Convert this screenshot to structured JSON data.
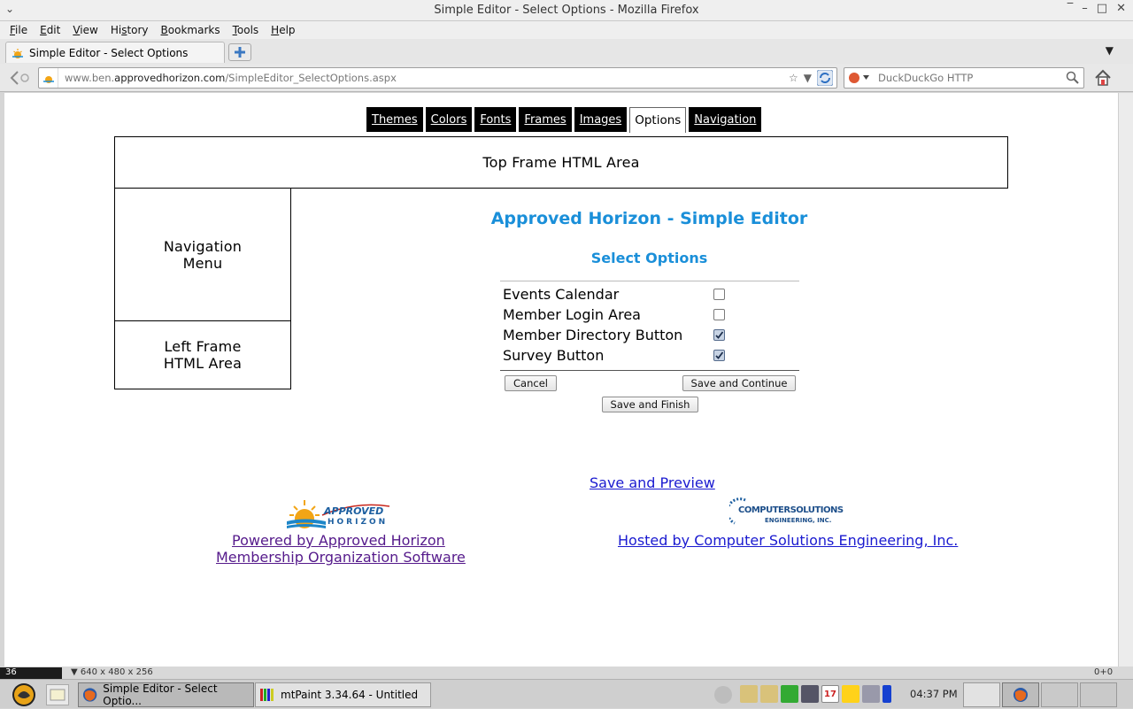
{
  "window": {
    "title": "Simple Editor - Select Options - Mozilla Firefox",
    "wm_left": "⌄",
    "wm_buttons": [
      "‾",
      "–",
      "□",
      "✕"
    ]
  },
  "menubar": [
    {
      "u": "F",
      "rest": "ile"
    },
    {
      "u": "E",
      "rest": "dit"
    },
    {
      "u": "V",
      "rest": "iew"
    },
    {
      "pre": "Hi",
      "u": "s",
      "rest": "tory"
    },
    {
      "u": "B",
      "rest": "ookmarks"
    },
    {
      "u": "T",
      "rest": "ools"
    },
    {
      "u": "H",
      "rest": "elp"
    }
  ],
  "tab": {
    "label": "Simple Editor - Select Options",
    "list_glyph": "▼"
  },
  "navbar": {
    "url_prefix": "www.ben.",
    "url_domain": "approvedhorizon.com",
    "url_path": "/SimpleEditor_SelectOptions.aspx",
    "search_placeholder": "DuckDuckGo HTTP"
  },
  "editor_tabs": [
    {
      "label": "Themes",
      "active": false
    },
    {
      "label": "Colors",
      "active": false
    },
    {
      "label": "Fonts",
      "active": false
    },
    {
      "label": "Frames",
      "active": false
    },
    {
      "label": "Images",
      "active": false
    },
    {
      "label": "Options",
      "active": true
    },
    {
      "label": "Navigation",
      "active": false
    }
  ],
  "frames": {
    "top": "Top Frame HTML Area",
    "nav_line1": "Navigation",
    "nav_line2": "Menu",
    "left_line1": "Left Frame",
    "left_line2": "HTML Area"
  },
  "content": {
    "heading": "Approved Horizon - Simple Editor",
    "subheading": "Select Options",
    "options": [
      {
        "label": "Events Calendar",
        "checked": false
      },
      {
        "label": "Member Login Area",
        "checked": false
      },
      {
        "label": "Member Directory Button",
        "checked": true
      },
      {
        "label": "Survey Button",
        "checked": true
      }
    ],
    "cancel_label": "Cancel",
    "save_continue_label": "Save and Continue",
    "save_finish_label": "Save and Finish",
    "save_preview_label": "Save and Preview"
  },
  "footer": {
    "ah_logo_text_1": "APPROVED",
    "ah_logo_text_2": "HORIZON",
    "powered_line1": "Powered by Approved Horizon",
    "powered_line2": "Membership Organization Software",
    "cs_logo_text_1": "COMPUTERSOLUTIONS",
    "cs_logo_text_2": "ENGINEERING, INC.",
    "hosted": "Hosted by Computer Solutions Engineering, Inc."
  },
  "statusbar": {
    "left_num": "36",
    "image_info": "640 x 480 x 256",
    "coords": "0+0"
  },
  "taskbar": {
    "task1": "Simple Editor - Select Optio...",
    "task2": "mtPaint 3.34.64 - Untitled",
    "clock": "04:37 PM",
    "calendar_day": "17"
  },
  "colors": {
    "heading": "#1a8fd9",
    "link": "#1a1ad0",
    "visited_link": "#551a8b",
    "tab_bg": "#000000"
  }
}
